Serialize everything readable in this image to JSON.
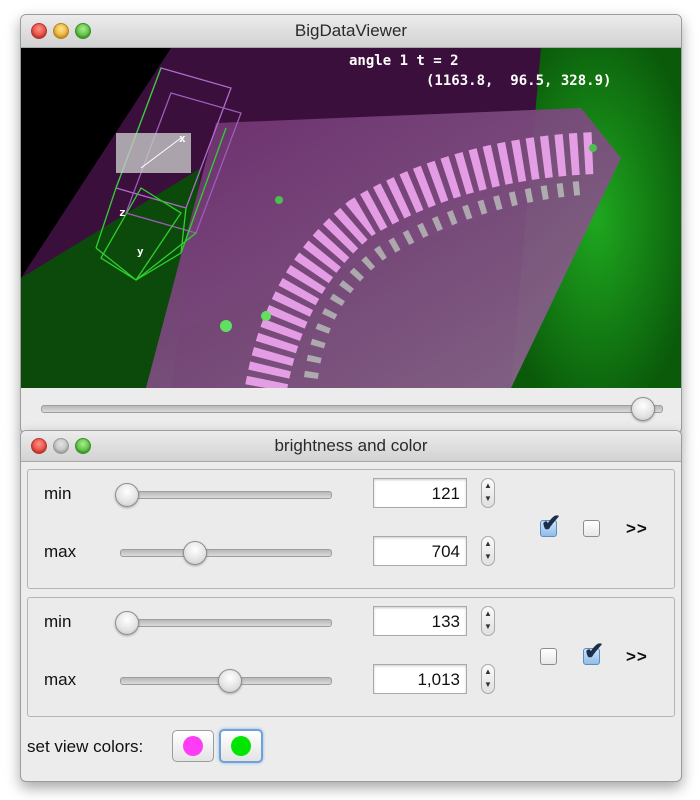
{
  "main_window": {
    "title": "BigDataViewer",
    "overlay": {
      "angle_text": "angle 1 t = 2",
      "coordinates": "(1163.8,  96.5, 328.9)",
      "axis_labels": {
        "x": "x",
        "y": "y",
        "z": "z"
      }
    },
    "time_slider": {
      "position_fraction": 0.97
    }
  },
  "brightness_window": {
    "title": "brightness and color",
    "groups": [
      {
        "min_label": "min",
        "min_value": "121",
        "min_slider_fraction": 0.03,
        "max_label": "max",
        "max_value": "704",
        "max_slider_fraction": 0.35,
        "checkbox_1_checked": true,
        "checkbox_2_checked": false,
        "more_label": ">>"
      },
      {
        "min_label": "min",
        "min_value": "133",
        "min_slider_fraction": 0.03,
        "max_label": "max",
        "max_value": "1,013",
        "max_slider_fraction": 0.52,
        "checkbox_1_checked": false,
        "checkbox_2_checked": true,
        "more_label": ">>"
      }
    ],
    "set_view_colors_label": "set view colors:",
    "colors": [
      "#ff3cf5",
      "#00e600"
    ]
  }
}
